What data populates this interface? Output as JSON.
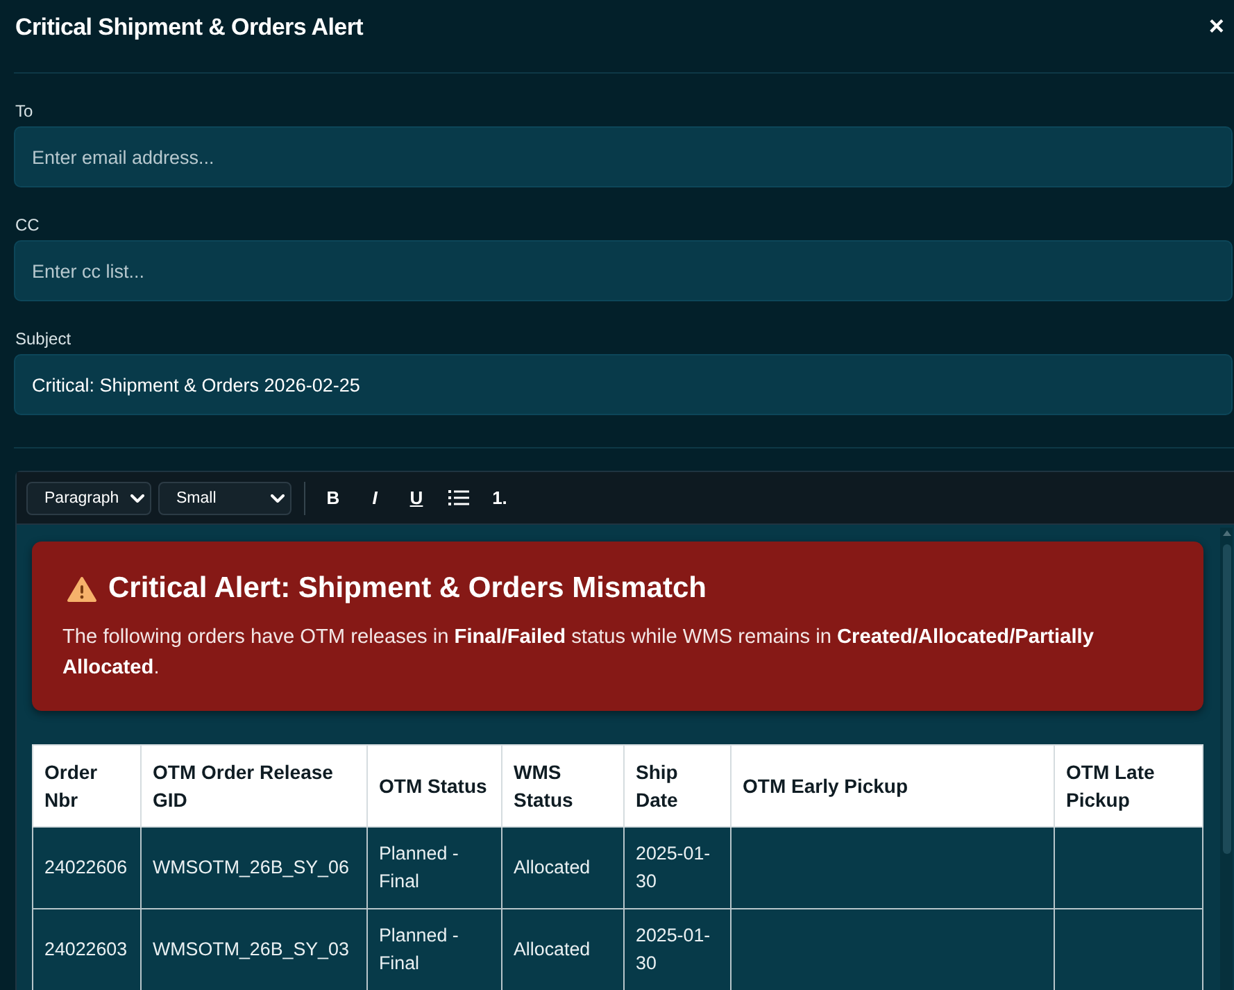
{
  "dialog": {
    "title": "Critical Shipment & Orders Alert",
    "close": "×"
  },
  "fields": [
    {
      "label": "To",
      "placeholder": "Enter email address..."
    },
    {
      "label": "CC",
      "placeholder": "Enter cc list..."
    },
    {
      "label": "Subject",
      "value": "Critical: Shipment & Orders 2026-02-25"
    }
  ],
  "editor": {
    "dropdowns": [
      {
        "value": "Paragraph"
      },
      {
        "value": "Small"
      }
    ],
    "buttons": [
      {
        "kind": "bold",
        "label": "B"
      },
      {
        "kind": "italic",
        "label": "I"
      },
      {
        "kind": "underline",
        "label": "U"
      },
      {
        "kind": "bullet-list"
      },
      {
        "kind": "numbered-list",
        "label": "1."
      }
    ],
    "alert": {
      "title": "Critical Alert: Shipment & Orders Mismatch",
      "message": "The following orders have OTM releases in **Final/Failed** status while WMS remains in **Created/Allocated/Partially Allocated**."
    },
    "table": {
      "columns": [
        "Order Nbr",
        "OTM Order Release GID",
        "OTM Status",
        "WMS Status",
        "Ship Date",
        "OTM Early Pickup",
        "OTM Late Pickup"
      ],
      "rows": [
        {
          "cells": [
            "24022606",
            "WMSOTM_26B_SY_06",
            "Planned - Final",
            "Allocated",
            "2025-01-30"
          ]
        },
        {
          "cells": [
            "24022603",
            "WMSOTM_26B_SY_03",
            "Planned - Final",
            "Allocated",
            "2025-01-30"
          ]
        }
      ]
    }
  }
}
